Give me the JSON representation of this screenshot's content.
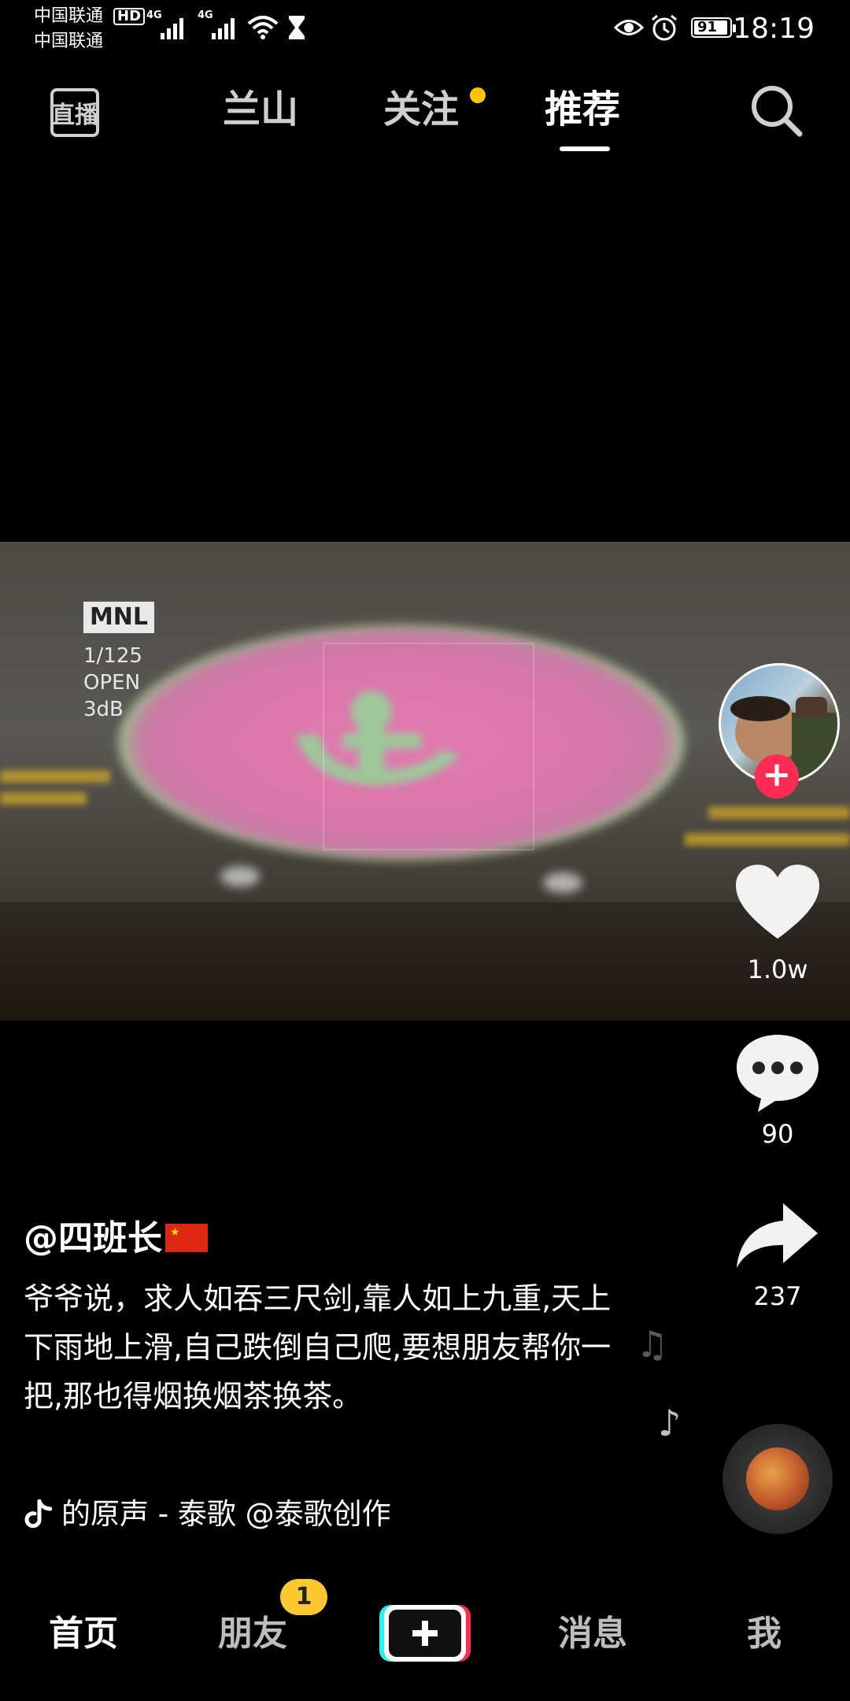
{
  "status_bar": {
    "carrier1": "中国联通",
    "carrier2": "中国联通",
    "hd": "HD",
    "net1": "4G",
    "net2": "4G",
    "battery": "91",
    "time": "18:19"
  },
  "top_nav": {
    "live_label": "直播",
    "tabs": [
      "兰山",
      "关注",
      "推荐"
    ],
    "active_tab": "推荐",
    "follow_dot_color": "#ffc300"
  },
  "video_overlay": {
    "mode": "MNL",
    "shutter": "1/125",
    "aperture": "OPEN",
    "gain": "3dB"
  },
  "rail": {
    "likes": "1.0w",
    "comments": "90",
    "shares": "237",
    "follow_color": "#fe2c55"
  },
  "post": {
    "author": "@四班长",
    "description": "爷爷说，求人如吞三尺剑,靠人如上九重,天上下雨地上滑,自己跌倒自己爬,要想朋友帮你一把,那也得烟换烟茶换茶。",
    "music": "的原声 - 泰歌    @泰歌创作"
  },
  "bottom_nav": {
    "tabs": [
      "首页",
      "朋友",
      "消息",
      "我"
    ],
    "active": "首页",
    "friends_badge": "1"
  }
}
